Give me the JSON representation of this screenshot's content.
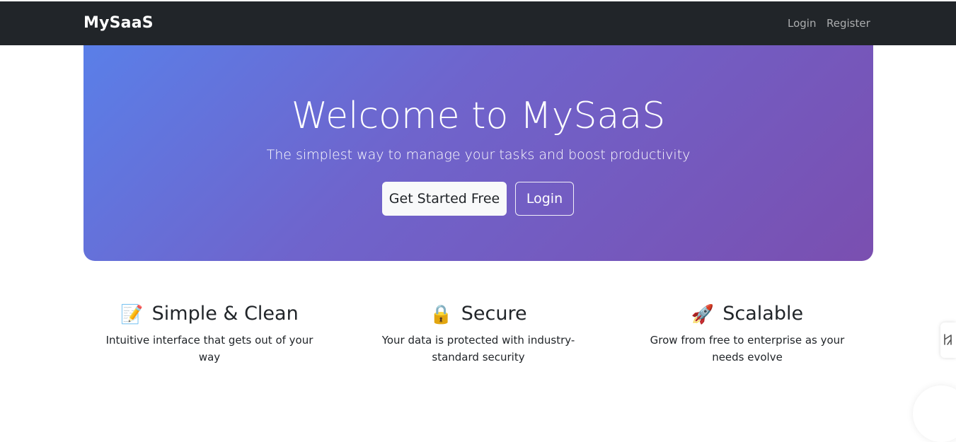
{
  "navbar": {
    "brand": "MySaaS",
    "links": [
      {
        "label": "Login"
      },
      {
        "label": "Register"
      }
    ]
  },
  "hero": {
    "title": "Welcome to MySaaS",
    "subtitle": "The simplest way to manage your tasks and boost productivity",
    "primary_button": "Get Started Free",
    "secondary_button": "Login",
    "gradient_colors": [
      "#5a7fe8",
      "#7a4fb0"
    ]
  },
  "features": [
    {
      "icon": "📝",
      "icon_name": "memo-icon",
      "title": "Simple & Clean",
      "description": "Intuitive interface that gets out of your way"
    },
    {
      "icon": "🔒",
      "icon_name": "lock-icon",
      "title": "Secure",
      "description": "Your data is protected with industry-standard security"
    },
    {
      "icon": "🚀",
      "icon_name": "rocket-icon",
      "title": "Scalable",
      "description": "Grow from free to enterprise as your needs evolve"
    }
  ],
  "colors": {
    "navbar_bg": "#212529",
    "text": "#212529"
  }
}
